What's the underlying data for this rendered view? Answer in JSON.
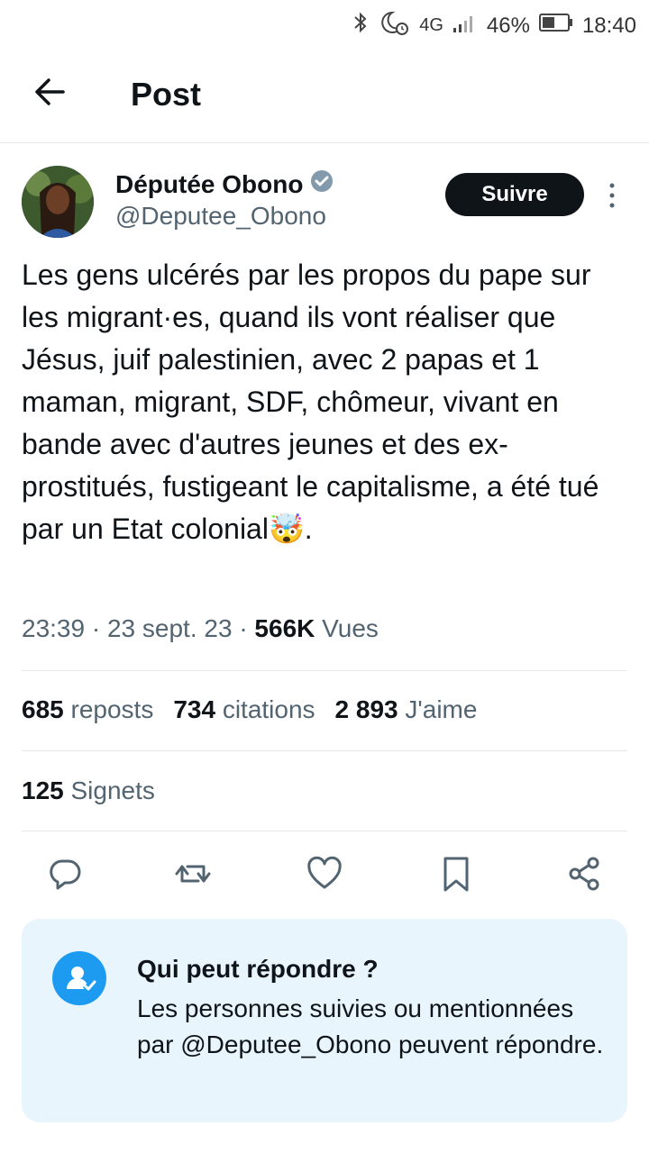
{
  "status_bar": {
    "network": "4G",
    "battery": "46%",
    "time": "18:40"
  },
  "header": {
    "title": "Post"
  },
  "post": {
    "author_name": "Députée Obono",
    "author_handle": "@Deputee_Obono",
    "follow_label": "Suivre",
    "text": "Les gens ulcérés par les propos du pape sur les migrant·es, quand ils vont réaliser que Jésus, juif palestinien, avec 2 papas et 1 maman, migrant, SDF, chômeur, vivant en bande avec d'autres jeunes et des ex-prostitués, fustigeant le capitalisme, a été tué par un Etat colonial🤯.",
    "time": "23:39",
    "date": "23 sept. 23",
    "views_count": "566K",
    "views_label": "Vues",
    "reposts_count": "685",
    "reposts_label": "reposts",
    "quotes_count": "734",
    "quotes_label": "citations",
    "likes_count": "2 893",
    "likes_label": "J'aime",
    "bookmarks_count": "125",
    "bookmarks_label": "Signets"
  },
  "reply_info": {
    "title": "Qui peut répondre ?",
    "description": "Les personnes suivies ou mentionnées par @Deputee_Obono peuvent répondre."
  },
  "colors": {
    "accent": "#1d9bf0",
    "secondary_text": "#536471",
    "primary_text": "#0f1419",
    "reply_bg": "#e8f5fd"
  }
}
